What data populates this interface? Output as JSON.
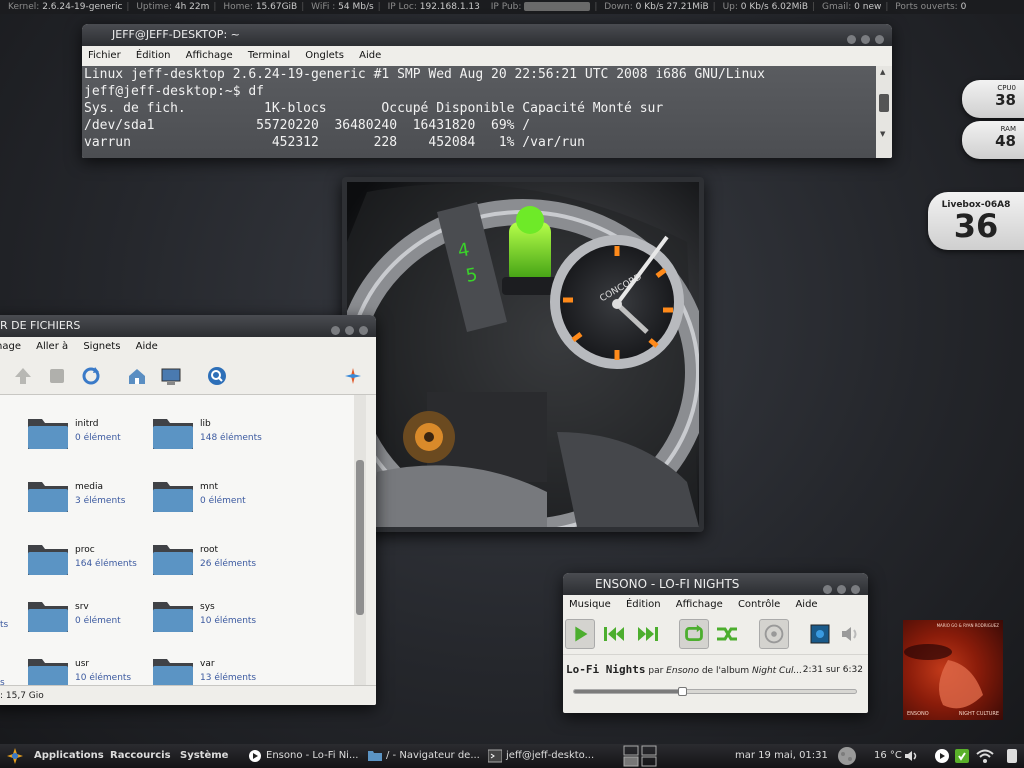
{
  "topbar": {
    "kernel_label": "Kernel:",
    "kernel": "2.6.24-19-generic",
    "uptime_label": "Uptime:",
    "uptime": "4h 22m",
    "home_label": "Home:",
    "home": "15.67GiB",
    "wifi_label": "WiFi :",
    "wifi": "54 Mb/s",
    "iploc_label": "IP Loc:",
    "iploc": "192.168.1.13",
    "ippub_label": "IP Pub:",
    "down_label": "Down:",
    "down": "0 Kb/s 27.21MiB",
    "up_label": "Up:",
    "up": "0 Kb/s 6.02MiB",
    "gmail_label": "Gmail:",
    "gmail": "0 new",
    "ports_label": "Ports ouverts:",
    "ports": "0"
  },
  "terminal": {
    "title": "JEFF@JEFF-DESKTOP: ~",
    "menu": [
      "Fichier",
      "Édition",
      "Affichage",
      "Terminal",
      "Onglets",
      "Aide"
    ],
    "lines": [
      "Linux jeff-desktop 2.6.24-19-generic #1 SMP Wed Aug 20 22:56:21 UTC 2008 i686 GNU/Linux",
      "jeff@jeff-desktop:~$ df",
      "Sys. de fich.          1K-blocs       Occupé Disponible Capacité Monté sur",
      "/dev/sda1             55720220  36480240  16431820  69% /",
      "varrun                  452312       228    452084   1% /var/run"
    ]
  },
  "filemgr": {
    "title": "R DE FICHIERS",
    "menu": [
      "hage",
      "Aller à",
      "Signets",
      "Aide"
    ],
    "folders": [
      {
        "name": "initrd",
        "count": "0 élément"
      },
      {
        "name": "lib",
        "count": "148 éléments"
      },
      {
        "name": "media",
        "count": "3 éléments"
      },
      {
        "name": "mnt",
        "count": "0 élément"
      },
      {
        "name": "proc",
        "count": "164 éléments"
      },
      {
        "name": "root",
        "count": "26 éléments"
      },
      {
        "name": "srv",
        "count": "0 élément"
      },
      {
        "name": "sys",
        "count": "10 éléments"
      },
      {
        "name": "usr",
        "count": "10 éléments"
      },
      {
        "name": "var",
        "count": "13 éléments"
      }
    ],
    "left_edge": [
      "ts",
      "s"
    ],
    "status": ": 15,7 Gio"
  },
  "player": {
    "title": "ENSONO - LO-FI NIGHTS",
    "menu": [
      "Musique",
      "Édition",
      "Affichage",
      "Contrôle",
      "Aide"
    ],
    "song": "Lo-Fi Nights",
    "par": "par",
    "artist": "Ensono",
    "de_album": "de l'album",
    "album": "Night Cul...",
    "time": "2:31 sur 6:32",
    "progress": 0.385
  },
  "widgets": {
    "cpu_label": "CPU0",
    "cpu_value": "38",
    "ram_label": "RAM",
    "ram_value": "48",
    "livebox_label": "Livebox-06A8",
    "livebox_value": "36"
  },
  "album_art": {
    "artist_credit": "ENSONO",
    "album_credit": "NIGHT CULTURE",
    "top_credit": "MARIO GO & RYAN RODRIGUEZ"
  },
  "panel": {
    "applications": "Applications",
    "raccourcis": "Raccourcis",
    "systeme": "Système",
    "task1": "Ensono - Lo-Fi Ni...",
    "task2": "/ - Navigateur de...",
    "task3": "jeff@jeff-deskto...",
    "datetime": "mar 19 mai, 01:31",
    "temperature": "16 °C"
  },
  "colors": {
    "desktop_bg": "#25272c",
    "terminal_bg": "#535559",
    "folder_blue": "#5b94c4",
    "player_green": "#4cae2e",
    "link_blue": "#3c5aa0"
  }
}
